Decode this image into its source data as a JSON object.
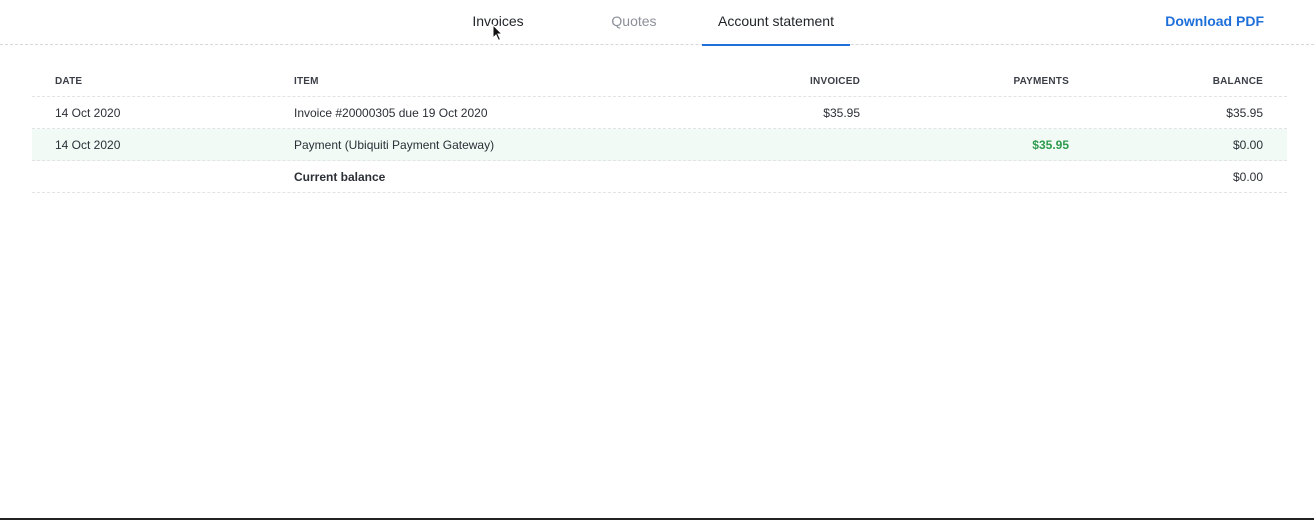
{
  "tabs": {
    "invoices": "Invoices",
    "quotes": "Quotes",
    "statement": "Account statement"
  },
  "actions": {
    "download": "Download PDF"
  },
  "colors": {
    "accent": "#1e6fd9",
    "payment_green": "#2e9b4f"
  },
  "table": {
    "headers": {
      "date": "DATE",
      "item": "ITEM",
      "invoiced": "INVOICED",
      "payments": "PAYMENTS",
      "balance": "BALANCE"
    },
    "rows": [
      {
        "date": "14 Oct 2020",
        "item": "Invoice #20000305 due 19 Oct 2020",
        "invoiced": "$35.95",
        "payments": "",
        "balance": "$35.95"
      },
      {
        "date": "14 Oct 2020",
        "item": "Payment (Ubiquiti Payment Gateway)",
        "invoiced": "",
        "payments": "$35.95",
        "balance": "$0.00"
      }
    ],
    "total": {
      "label": "Current balance",
      "balance": "$0.00"
    }
  }
}
